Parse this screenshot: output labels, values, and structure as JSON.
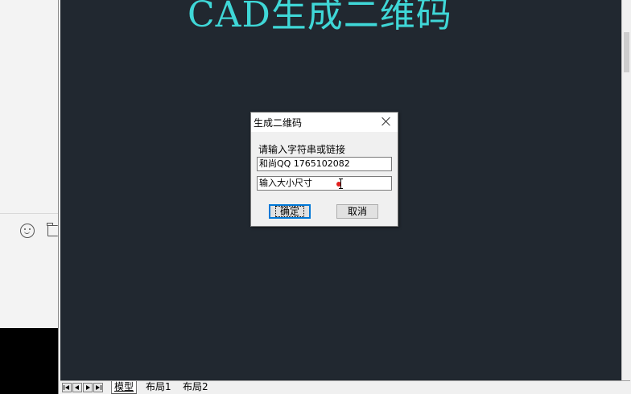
{
  "cad": {
    "drawing_text": "CAD生成二维码",
    "tabs": {
      "model": "模型",
      "layout1": "布局1",
      "layout2": "布局2"
    }
  },
  "dialog": {
    "title": "生成二维码",
    "prompt_label": "请输入字符串或链接",
    "string_input_value": "和尚QQ 1765102082",
    "size_input_value": "输入大小尺寸",
    "ok_label": "确定",
    "cancel_label": "取消"
  },
  "colors": {
    "canvas_bg": "#212830",
    "drawing_text": "#3fd7d7",
    "cursor_dot": "#e0201e"
  }
}
